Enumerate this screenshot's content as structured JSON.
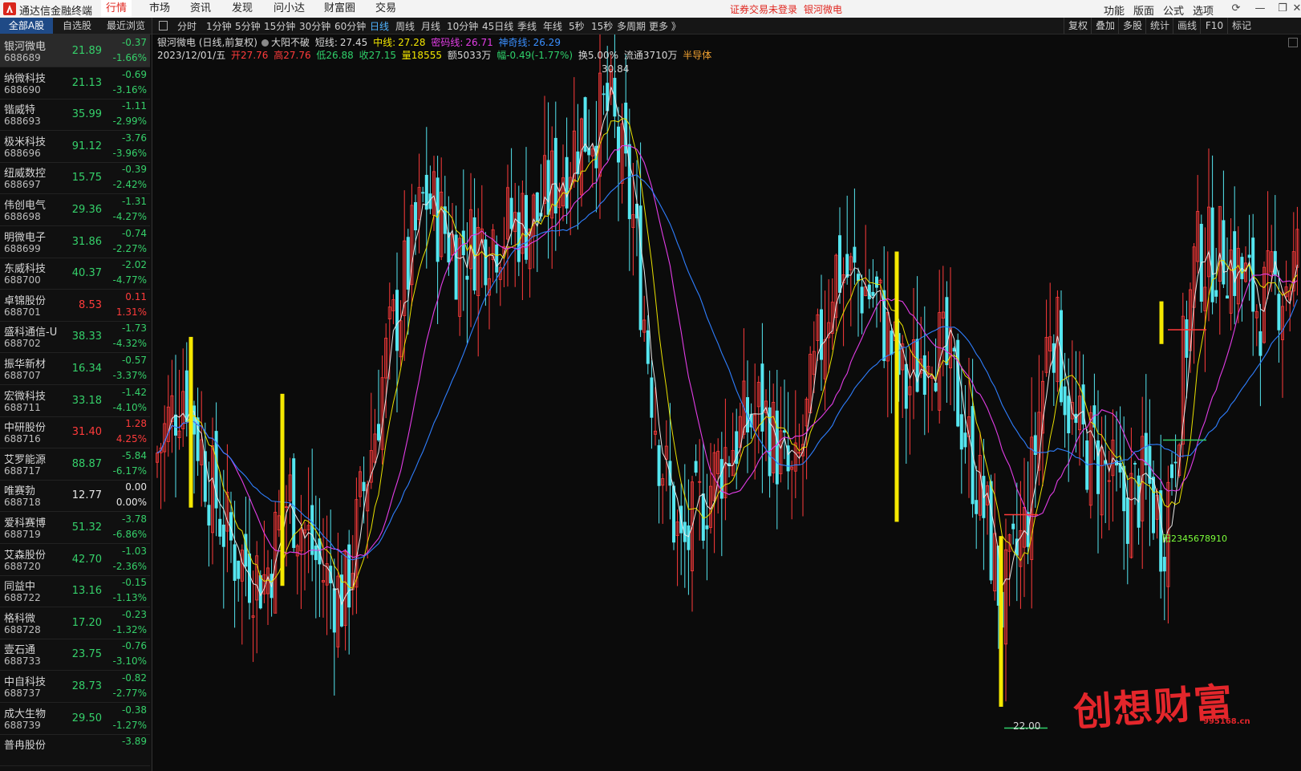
{
  "menubar": {
    "app_title": "通达信金融终端",
    "menus": [
      "行情",
      "市场",
      "资讯",
      "发现",
      "问小达",
      "财富圈",
      "交易"
    ],
    "notice": "证券交易未登录",
    "notice_stock": "银河微电",
    "right_menus": [
      "功能",
      "版面",
      "公式",
      "选项"
    ]
  },
  "list_tabs": [
    "全部A股",
    "自选股",
    "最近浏览"
  ],
  "stocks": [
    {
      "name": "银河微电",
      "code": "688689",
      "price": "21.89",
      "change": "-0.37",
      "pct": "-1.66%",
      "dir": "dn"
    },
    {
      "name": "纳微科技",
      "code": "688690",
      "price": "21.13",
      "change": "-0.69",
      "pct": "-3.16%",
      "dir": "dn"
    },
    {
      "name": "锴威特",
      "code": "688693",
      "price": "35.99",
      "change": "-1.11",
      "pct": "-2.99%",
      "dir": "dn"
    },
    {
      "name": "极米科技",
      "code": "688696",
      "price": "91.12",
      "change": "-3.76",
      "pct": "-3.96%",
      "dir": "dn"
    },
    {
      "name": "纽威数控",
      "code": "688697",
      "price": "15.75",
      "change": "-0.39",
      "pct": "-2.42%",
      "dir": "dn"
    },
    {
      "name": "伟创电气",
      "code": "688698",
      "price": "29.36",
      "change": "-1.31",
      "pct": "-4.27%",
      "dir": "dn"
    },
    {
      "name": "明微电子",
      "code": "688699",
      "price": "31.86",
      "change": "-0.74",
      "pct": "-2.27%",
      "dir": "dn"
    },
    {
      "name": "东威科技",
      "code": "688700",
      "price": "40.37",
      "change": "-2.02",
      "pct": "-4.77%",
      "dir": "dn"
    },
    {
      "name": "卓锦股份",
      "code": "688701",
      "price": "8.53",
      "change": "0.11",
      "pct": "1.31%",
      "dir": "up"
    },
    {
      "name": "盛科通信-U",
      "code": "688702",
      "price": "38.33",
      "change": "-1.73",
      "pct": "-4.32%",
      "dir": "dn"
    },
    {
      "name": "振华新材",
      "code": "688707",
      "price": "16.34",
      "change": "-0.57",
      "pct": "-3.37%",
      "dir": "dn"
    },
    {
      "name": "宏微科技",
      "code": "688711",
      "price": "33.18",
      "change": "-1.42",
      "pct": "-4.10%",
      "dir": "dn"
    },
    {
      "name": "中研股份",
      "code": "688716",
      "price": "31.40",
      "change": "1.28",
      "pct": "4.25%",
      "dir": "up"
    },
    {
      "name": "艾罗能源",
      "code": "688717",
      "price": "88.87",
      "change": "-5.84",
      "pct": "-6.17%",
      "dir": "dn"
    },
    {
      "name": "唯赛勃",
      "code": "688718",
      "price": "12.77",
      "change": "0.00",
      "pct": "0.00%",
      "dir": "fl"
    },
    {
      "name": "爱科赛博",
      "code": "688719",
      "price": "51.32",
      "change": "-3.78",
      "pct": "-6.86%",
      "dir": "dn"
    },
    {
      "name": "艾森股份",
      "code": "688720",
      "price": "42.70",
      "change": "-1.03",
      "pct": "-2.36%",
      "dir": "dn"
    },
    {
      "name": "同益中",
      "code": "688722",
      "price": "13.16",
      "change": "-0.15",
      "pct": "-1.13%",
      "dir": "dn"
    },
    {
      "name": "格科微",
      "code": "688728",
      "price": "17.20",
      "change": "-0.23",
      "pct": "-1.32%",
      "dir": "dn"
    },
    {
      "name": "壹石通",
      "code": "688733",
      "price": "23.75",
      "change": "-0.76",
      "pct": "-3.10%",
      "dir": "dn"
    },
    {
      "name": "中自科技",
      "code": "688737",
      "price": "28.73",
      "change": "-0.82",
      "pct": "-2.77%",
      "dir": "dn"
    },
    {
      "name": "成大生物",
      "code": "688739",
      "price": "29.50",
      "change": "-0.38",
      "pct": "-1.27%",
      "dir": "dn"
    },
    {
      "name": "普冉股份",
      "code": "",
      "price": "",
      "change": "-3.89",
      "pct": "",
      "dir": "dn"
    }
  ],
  "periods": [
    "分时",
    "1分钟",
    "5分钟",
    "15分钟",
    "30分钟",
    "60分钟",
    "日线",
    "周线",
    "月线",
    "10分钟",
    "45日线",
    "季线",
    "年线",
    "5秒",
    "15秒",
    "多周期",
    "更多 》"
  ],
  "active_period": "日线",
  "right_buttons": [
    "复权",
    "叠加",
    "多股",
    "统计",
    "画线",
    "F10",
    "标记"
  ],
  "chart_header": {
    "title": "银河微电 (日线,前复权)",
    "indicator": "大阳不破",
    "short_label": "短线:",
    "short_val": "27.45",
    "mid_label": "中线:",
    "mid_val": "27.28",
    "code_label": "密码线:",
    "code_val": "26.71",
    "magic_label": "神奇线:",
    "magic_val": "26.29",
    "date": "2023/12/01/五",
    "open": "开27.76",
    "high": "高27.76",
    "low": "低26.88",
    "close": "收27.15",
    "vol": "量18555",
    "amount": "额5033万",
    "range": "幅-0.49(-1.77%)",
    "turnover": "换5.00%",
    "float": "流通3710万",
    "sector": "半导体"
  },
  "annotations": {
    "high_label": "30.84",
    "low_label": "22.00",
    "signal_label": "阳2345678910"
  },
  "watermark": {
    "text": "创想财富",
    "url": "995168.cn"
  },
  "colors": {
    "up": "#ff3b3b",
    "down": "#55e6f0",
    "ma_white": "#e8e8e8",
    "ma_yellow": "#e8e000",
    "ma_magenta": "#e23de6",
    "ma_blue": "#2f7fff",
    "signal": "#f5e800"
  }
}
